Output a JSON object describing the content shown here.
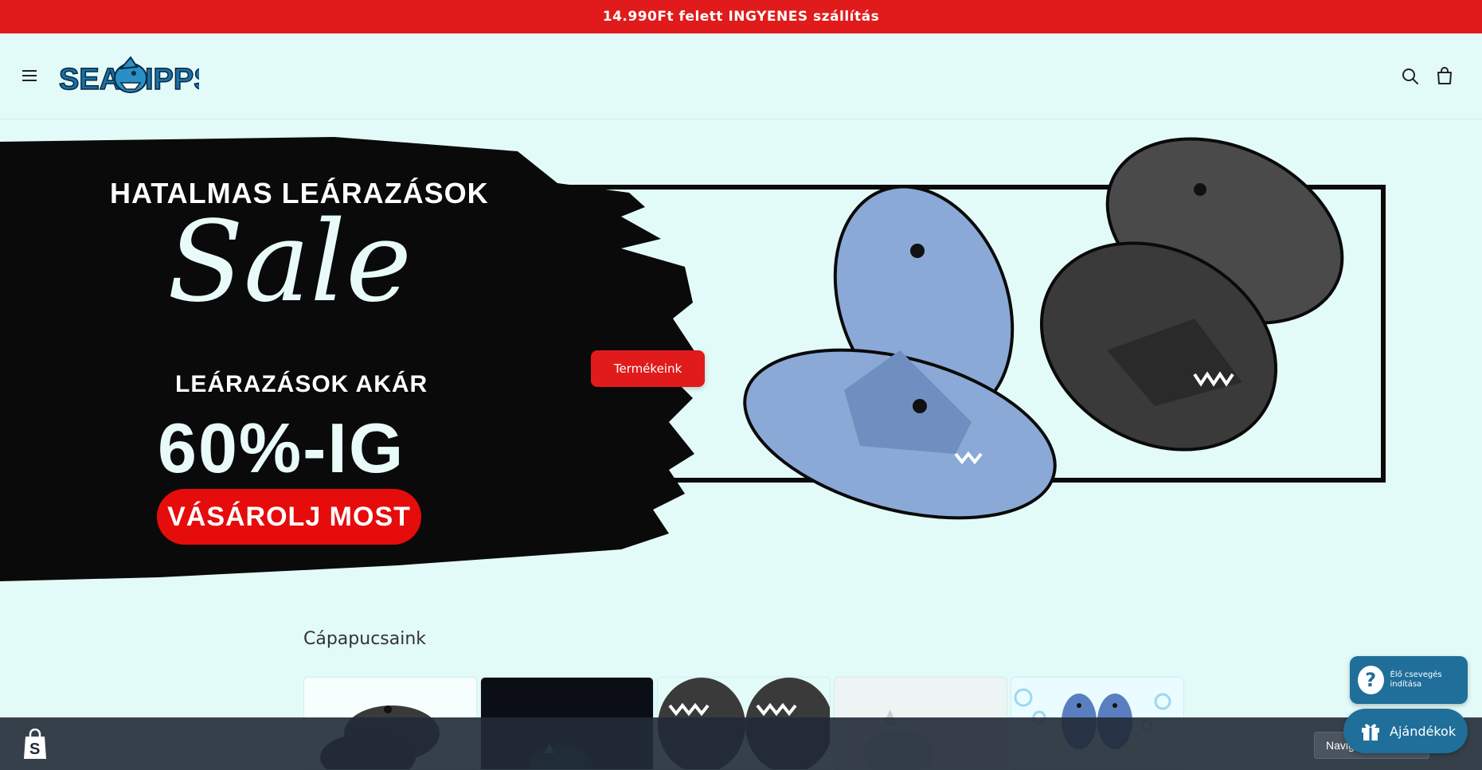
{
  "announcement": {
    "text": "14.990Ft felett INGYENES szállítás"
  },
  "header": {
    "logo_text": "SEAS",
    "logo_text_2": "IPPS",
    "menu_icon": "hamburger-icon",
    "search_icon": "search-icon",
    "cart_icon": "cart-icon"
  },
  "hero": {
    "headline": "HATALMAS LEÁRAZÁSOK",
    "sale_word": "Sale",
    "subline": "LEÁRAZÁSOK AKÁR",
    "percent": "60%-IG",
    "cta_image_text": "VÁSÁROLJ MOST",
    "button_label": "Termékeink"
  },
  "collection": {
    "title": "Cápapucsaink"
  },
  "widgets": {
    "chat_label": "Élő csevegés indítása",
    "gifts_label": "Ajándékok"
  },
  "bottom_bar": {
    "nav_button_label": "Navigáció"
  },
  "colors": {
    "accent_red": "#e11b1b",
    "background": "#e3fbf8",
    "widget_blue": "#1f6f9a"
  }
}
